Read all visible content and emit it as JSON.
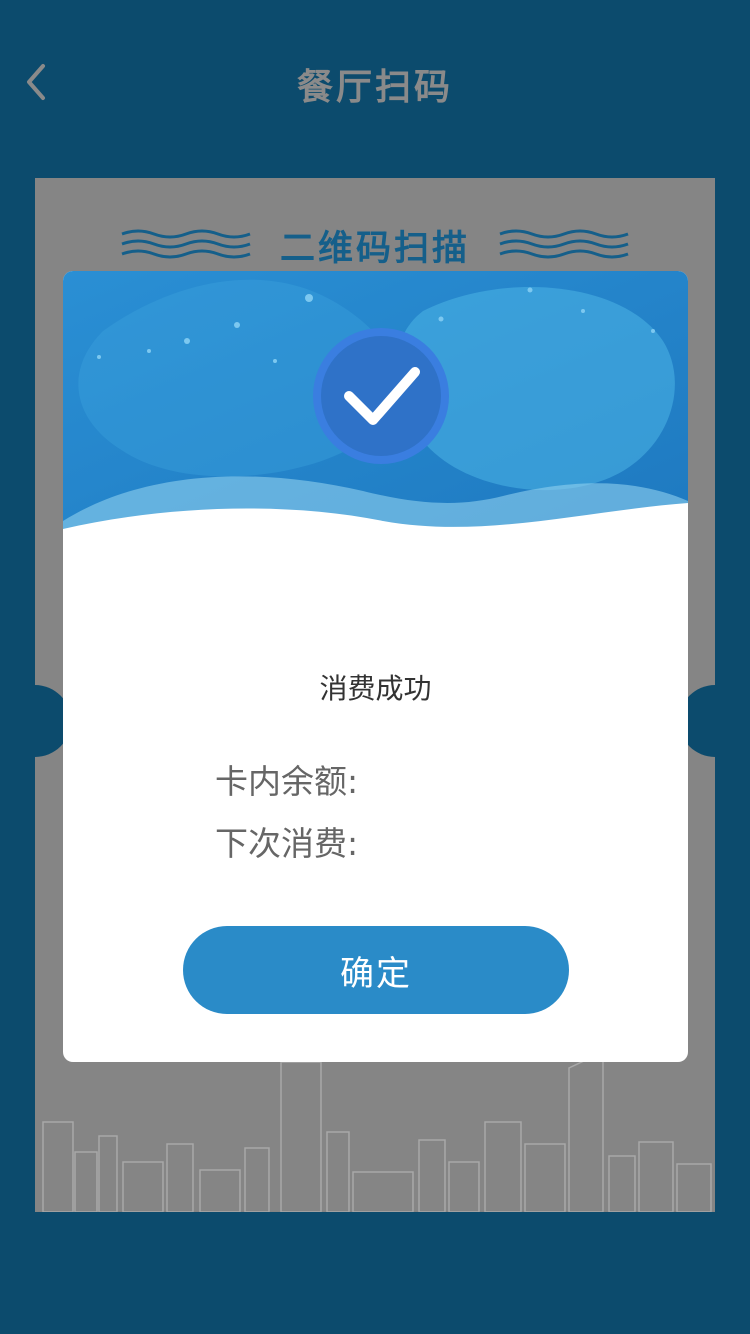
{
  "header": {
    "title": "餐厅扫码",
    "back_icon": "chevron-left-icon"
  },
  "card": {
    "title": "二维码扫描"
  },
  "dialog": {
    "status_icon": "check-circle-icon",
    "message": "消费成功",
    "balance_label": "卡内余额:",
    "next_charge_label": "下次消费:",
    "confirm_label": "确定"
  },
  "colors": {
    "background": "#0c4b6d",
    "card": "#858585",
    "accent": "#2a8bc8",
    "title_blue": "#155f8a"
  }
}
